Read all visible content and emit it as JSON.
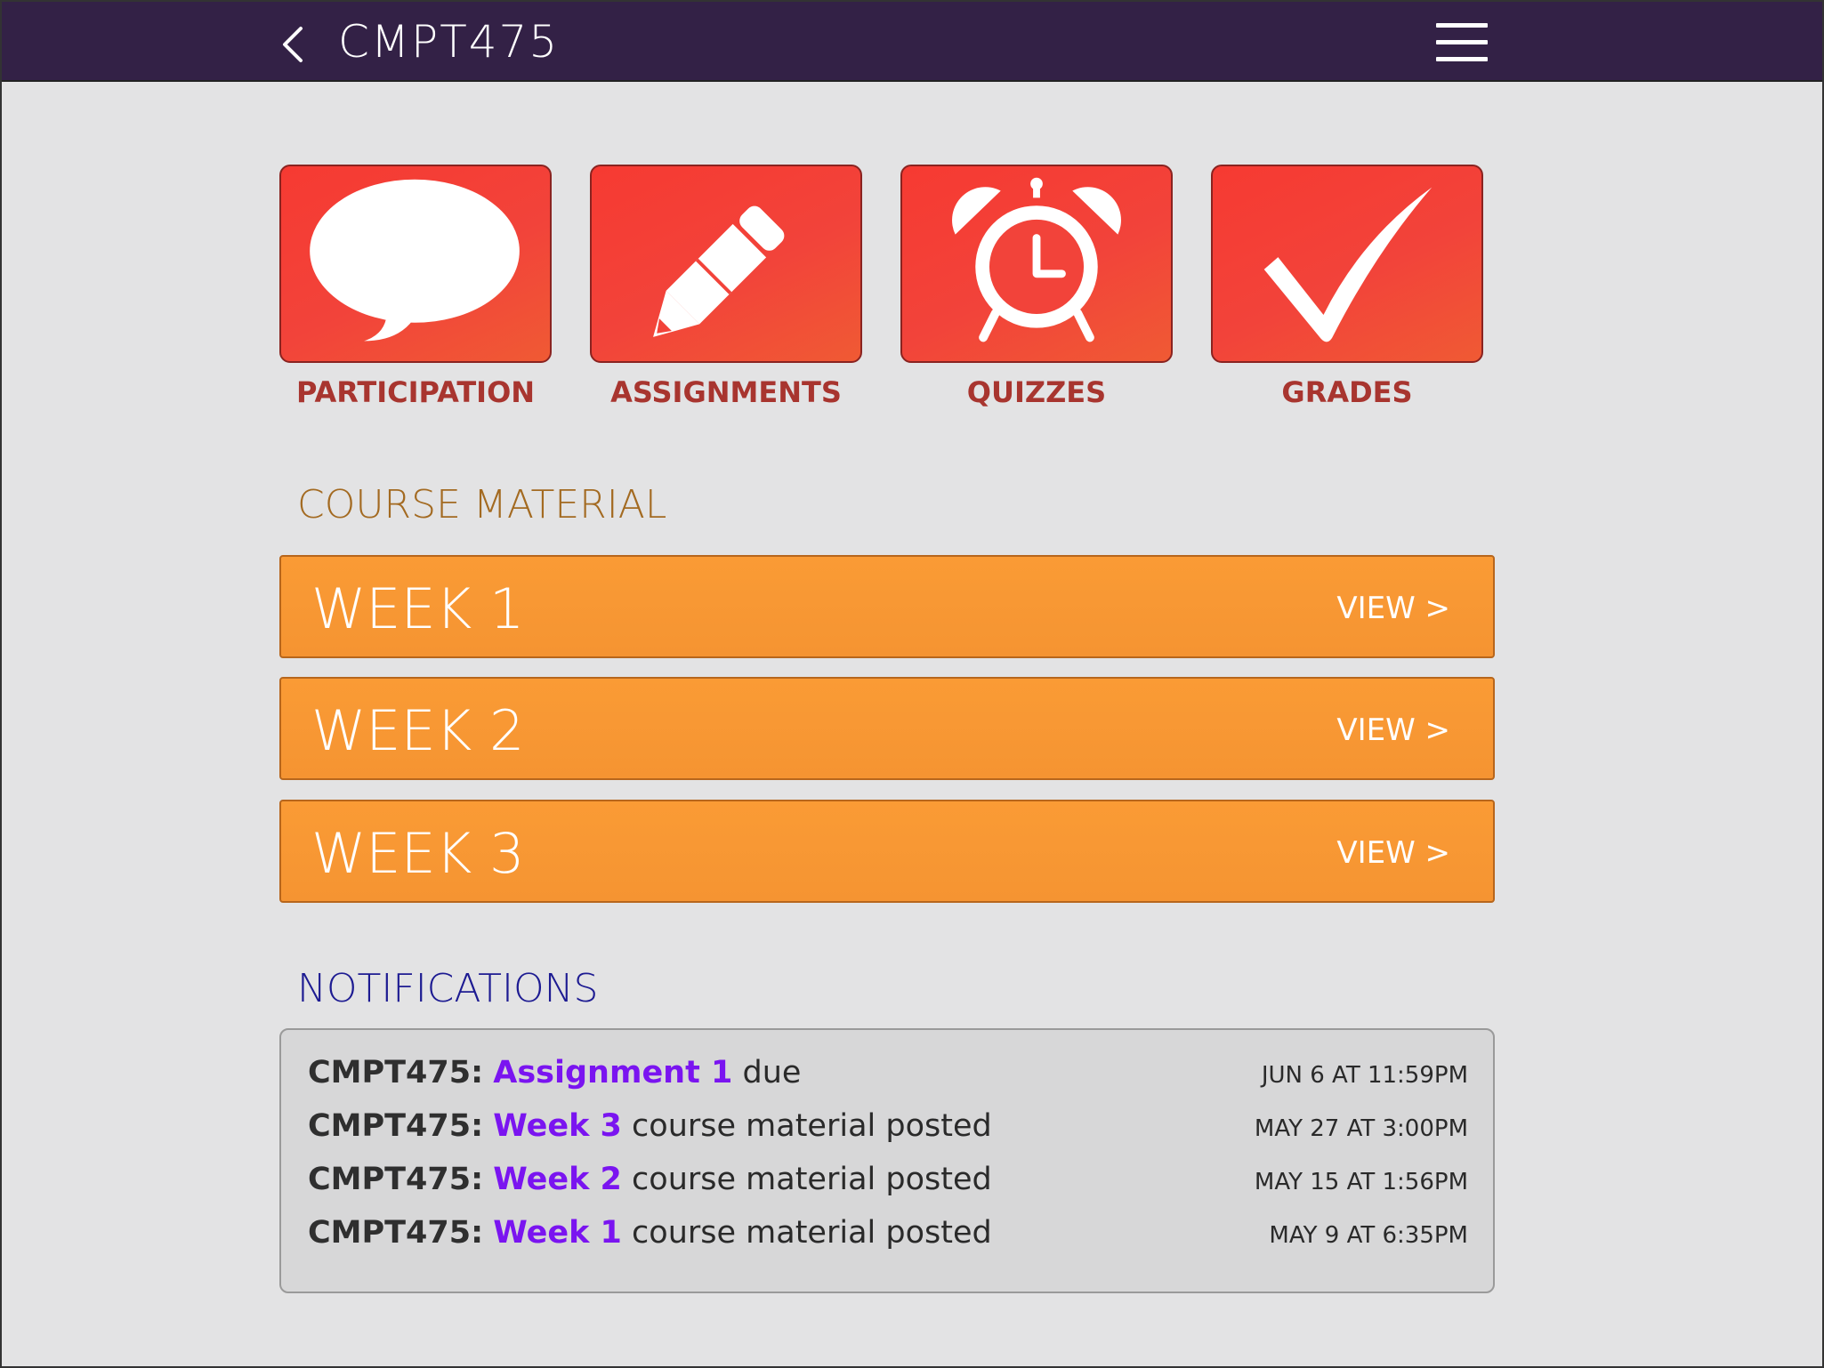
{
  "header": {
    "title": "CMPT475"
  },
  "tiles": [
    {
      "label": "PARTICIPATION",
      "icon": "speech-bubble-icon"
    },
    {
      "label": "ASSIGNMENTS",
      "icon": "pencil-icon"
    },
    {
      "label": "QUIZZES",
      "icon": "alarm-clock-icon"
    },
    {
      "label": "GRADES",
      "icon": "checkmark-icon"
    }
  ],
  "course_material": {
    "title": "COURSE MATERIAL",
    "weeks": [
      {
        "label": "WEEK 1",
        "view": "VIEW >"
      },
      {
        "label": "WEEK 2",
        "view": "VIEW >"
      },
      {
        "label": "WEEK 3",
        "view": "VIEW >"
      }
    ]
  },
  "notifications": {
    "title": "NOTIFICATIONS",
    "items": [
      {
        "course": "CMPT475:",
        "link": "Assignment 1",
        "text": "due",
        "time": "JUN 6 AT 11:59PM"
      },
      {
        "course": "CMPT475:",
        "link": "Week 3",
        "text": "course material posted",
        "time": "MAY 27 AT 3:00PM"
      },
      {
        "course": "CMPT475:",
        "link": "Week 2",
        "text": "course material posted",
        "time": "MAY 15 AT 1:56PM"
      },
      {
        "course": "CMPT475:",
        "link": "Week 1",
        "text": "course material posted",
        "time": "MAY 9 AT 6:35PM"
      }
    ]
  },
  "colors": {
    "header_bg": "#332146",
    "tile_red": "#f2433a",
    "tile_label": "#a8352f",
    "week_orange": "#f89a35",
    "course_material_title": "#a36a21",
    "notifications_title": "#1d1b92",
    "notification_link": "#7a14f0"
  }
}
